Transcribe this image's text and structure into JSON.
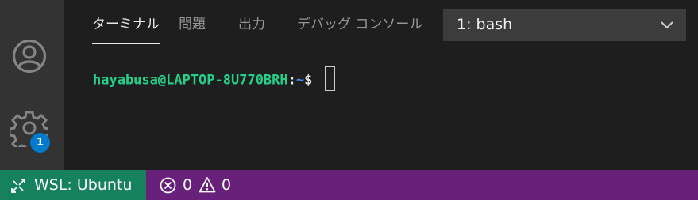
{
  "activity_bar": {
    "account_icon": "account-icon",
    "settings_icon": "gear-icon",
    "settings_badge": "1"
  },
  "panel": {
    "tabs": [
      {
        "label": "ターミナル",
        "active": true
      },
      {
        "label": "問題",
        "active": false
      },
      {
        "label": "出力",
        "active": false
      },
      {
        "label": "デバッグ コンソール",
        "active": false
      }
    ],
    "terminal_select": {
      "value": "1: bash",
      "icon": "chevron-down-icon"
    }
  },
  "terminal": {
    "user_host": "hayabusa@LAPTOP-8U770BRH",
    "colon": ":",
    "path": "~",
    "dollar": "$",
    "colors": {
      "user_host": "#23d18b",
      "path": "#3b8eea"
    }
  },
  "status_bar": {
    "remote_icon": "remote-icon",
    "remote_label": "WSL: Ubuntu",
    "errors": "0",
    "warnings": "0",
    "colors": {
      "background": "#68217a",
      "remote_background": "#16825d"
    }
  }
}
